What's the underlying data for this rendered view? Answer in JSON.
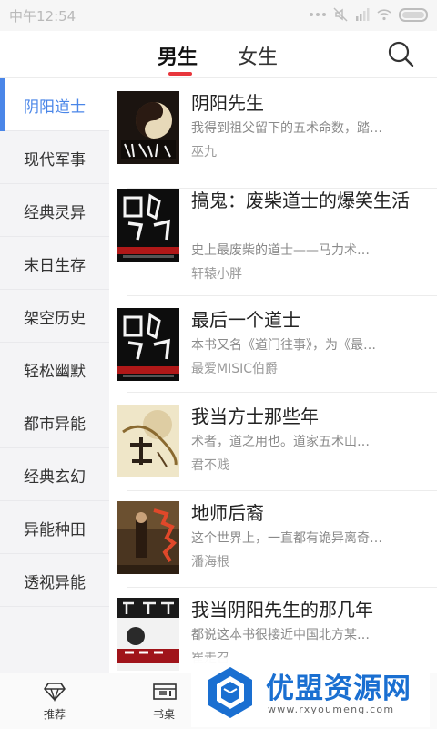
{
  "status_bar": {
    "time": "中午12:54"
  },
  "top_tabs": [
    {
      "label": "男生",
      "active": true
    },
    {
      "label": "女生",
      "active": false
    }
  ],
  "categories": [
    {
      "label": "阴阳道士",
      "active": true
    },
    {
      "label": "现代军事"
    },
    {
      "label": "经典灵异"
    },
    {
      "label": "末日生存"
    },
    {
      "label": "架空历史"
    },
    {
      "label": "轻松幽默"
    },
    {
      "label": "都市异能"
    },
    {
      "label": "经典玄幻"
    },
    {
      "label": "异能种田"
    },
    {
      "label": "透视异能"
    }
  ],
  "books": [
    {
      "title": "阴阳先生",
      "desc": "我得到祖父留下的五术命数，踏…",
      "author": "巫九"
    },
    {
      "title": "搞鬼：废柴道士的爆笑生活",
      "desc": "史上最废柴的道士——马力术…",
      "author": "轩辕小胖"
    },
    {
      "title": "最后一个道士",
      "desc": "本书又名《道门往事》，为《最…",
      "author": "最爱MISIC伯爵"
    },
    {
      "title": "我当方士那些年",
      "desc": "术者，道之用也。道家五术山…",
      "author": "君不贱"
    },
    {
      "title": "地师后裔",
      "desc": "这个世界上，一直都有诡异离奇…",
      "author": "潘海根"
    },
    {
      "title": "我当阴阳先生的那几年",
      "desc": "都说这本书很接近中国北方某…",
      "author": "崔走召"
    }
  ],
  "bottom_nav": [
    {
      "label": "推荐",
      "icon": "diamond-icon"
    },
    {
      "label": "书桌",
      "icon": "bookshelf-icon"
    }
  ],
  "watermark": {
    "title": "优盟资源网",
    "url": "www.rxyoumeng.com"
  },
  "colors": {
    "accent_blue": "#4a86e8",
    "tab_underline_red": "#e8363c"
  }
}
